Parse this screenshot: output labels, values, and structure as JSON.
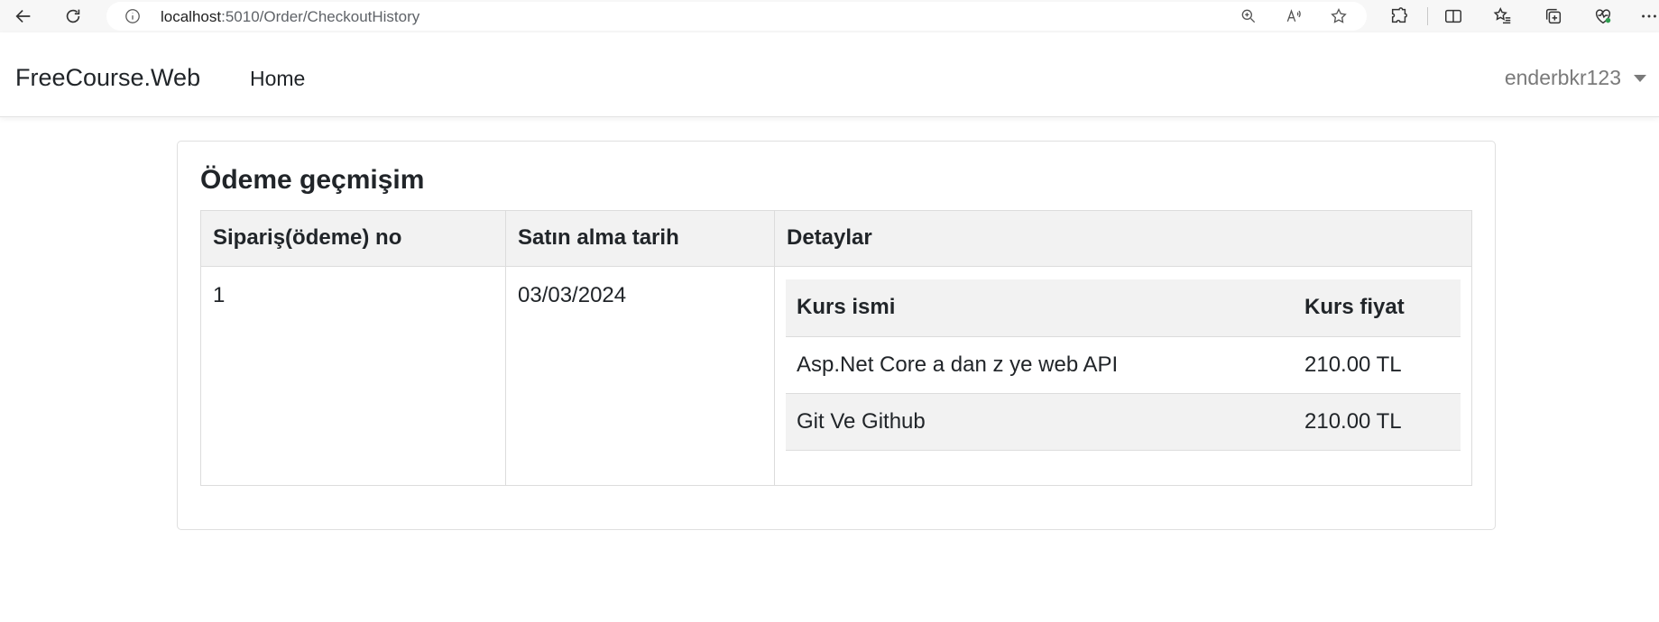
{
  "browser": {
    "url_host": "localhost",
    "url_path": ":5010/Order/CheckoutHistory"
  },
  "navbar": {
    "brand": "FreeCourse.Web",
    "home_link": "Home",
    "user_name": "enderbkr123"
  },
  "page": {
    "title": "Ödeme geçmişim",
    "columns": [
      "Sipariş(ödeme) no",
      "Satın alma tarih",
      "Detaylar"
    ],
    "orders": [
      {
        "id": "1",
        "date": "03/03/2024",
        "details": {
          "columns": [
            "Kurs ismi",
            "Kurs fiyat"
          ],
          "items": [
            {
              "name": "Asp.Net Core a dan z ye web API",
              "price": "210.00 TL"
            },
            {
              "name": "Git Ve Github",
              "price": "210.00 TL"
            }
          ]
        }
      }
    ]
  }
}
